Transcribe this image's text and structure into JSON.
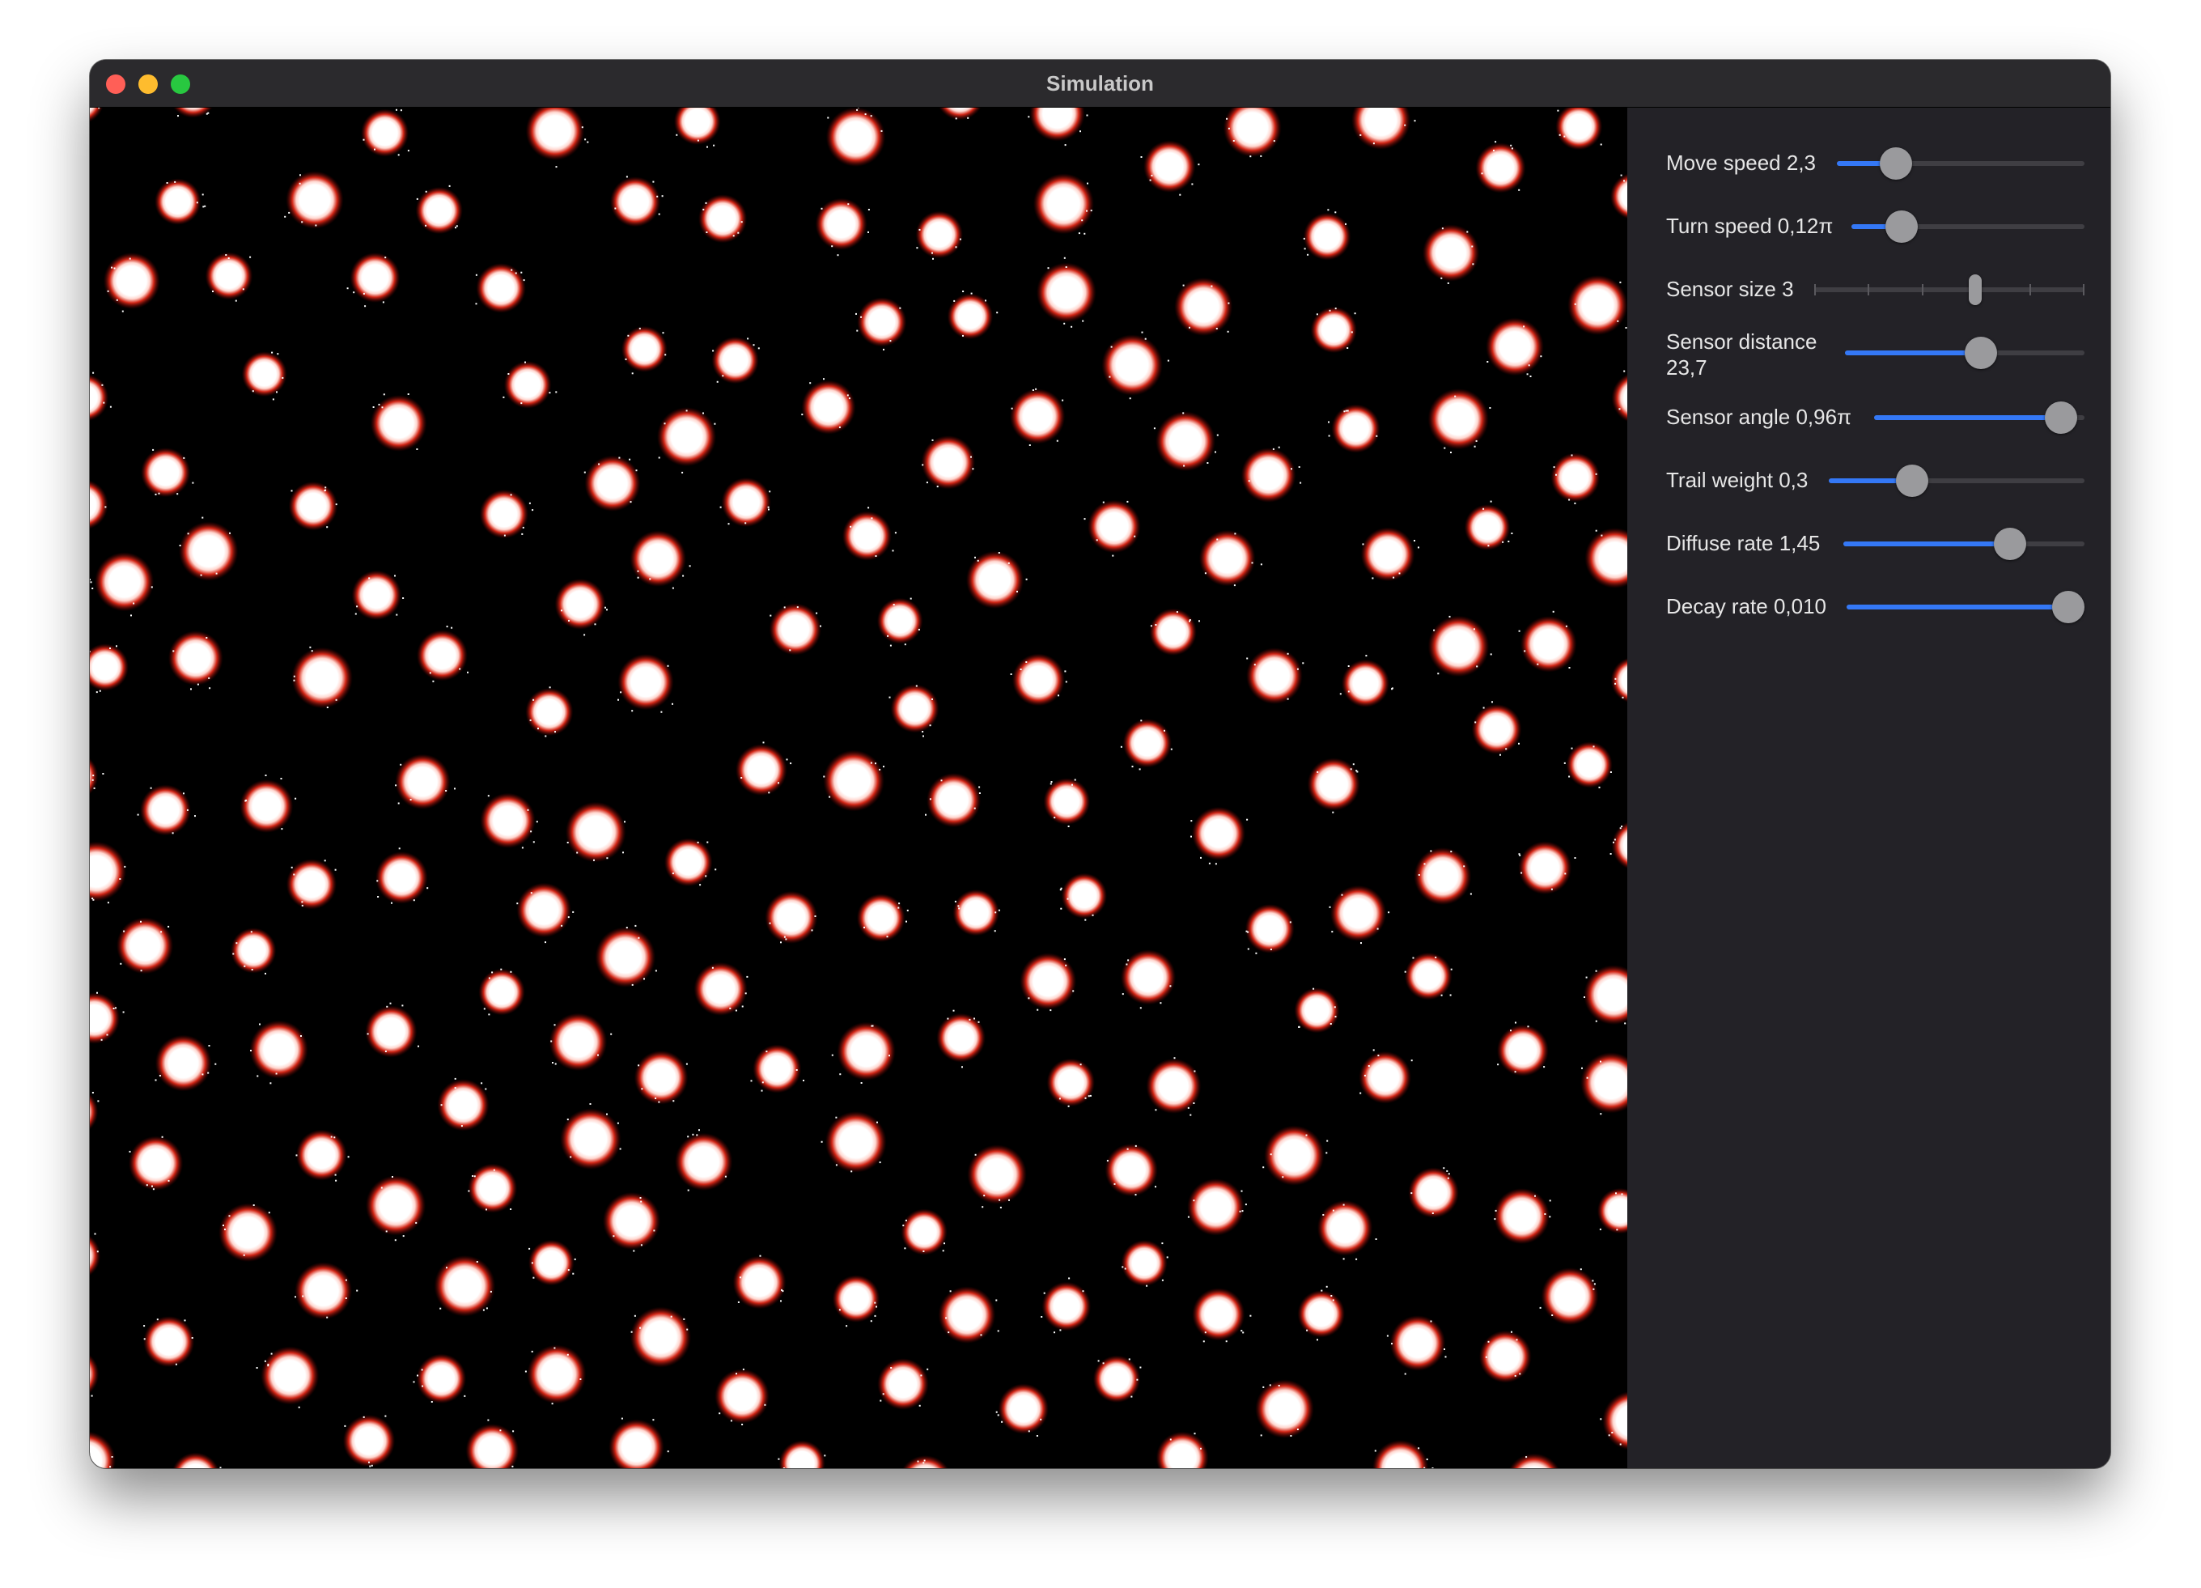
{
  "window": {
    "title": "Simulation"
  },
  "canvas": {
    "background": "#000000",
    "spot_core": "#ffffff",
    "spot_glow": "#c01a10"
  },
  "controls": [
    {
      "id": "move-speed",
      "label": "Move speed 2,3",
      "value_fraction": 0.2
    },
    {
      "id": "turn-speed",
      "label": "Turn speed 0,12π",
      "value_fraction": 0.17
    },
    {
      "id": "sensor-size",
      "label": "Sensor size 3",
      "discrete": true,
      "steps": 6,
      "value_fraction": 0.6
    },
    {
      "id": "sensor-distance",
      "label": "Sensor distance 23,7",
      "value_fraction": 0.58
    },
    {
      "id": "sensor-angle",
      "label": "Sensor angle 0,96π",
      "value_fraction": 0.96
    },
    {
      "id": "trail-weight",
      "label": "Trail weight 0,3",
      "value_fraction": 0.3
    },
    {
      "id": "diffuse-rate",
      "label": "Diffuse rate 1,45",
      "value_fraction": 0.72
    },
    {
      "id": "decay-rate",
      "label": "Decay rate 0,010",
      "value_fraction": 1.0
    }
  ],
  "colors": {
    "accent": "#3478f6",
    "panel": "#232227",
    "titlebar": "#2b2a2d"
  }
}
